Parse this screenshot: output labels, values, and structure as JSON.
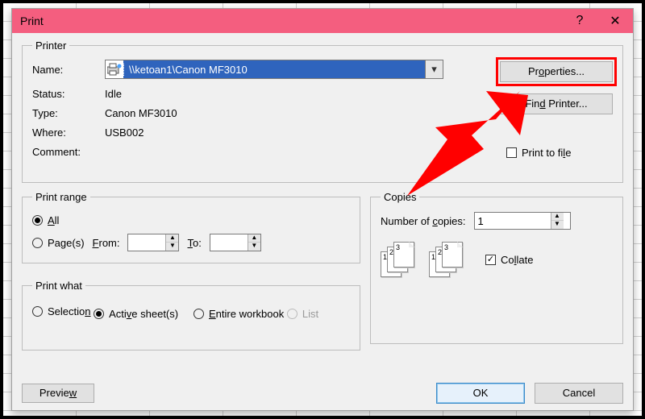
{
  "window": {
    "title": "Print"
  },
  "printer": {
    "legend": "Printer",
    "name_label": "Name:",
    "selected_printer": "\\\\ketoan1\\Canon MF3010",
    "status_label": "Status:",
    "status_value": "Idle",
    "type_label": "Type:",
    "type_value": "Canon MF3010",
    "where_label": "Where:",
    "where_value": "USB002",
    "comment_label": "Comment:",
    "properties_btn": "Properties...",
    "find_printer_btn": "Find Printer...",
    "print_to_file": "Print to file"
  },
  "print_range": {
    "legend": "Print range",
    "all": "All",
    "pages": "Page(s)",
    "from": "From:",
    "to": "To:"
  },
  "copies": {
    "legend": "Copies",
    "number_label": "Number of copies:",
    "number_value": "1",
    "collate": "Collate"
  },
  "print_what": {
    "legend": "Print what",
    "selection": "Selection",
    "entire_workbook": "Entire workbook",
    "active_sheets": "Active sheet(s)",
    "list": "List"
  },
  "footer": {
    "preview": "Preview",
    "ok": "OK",
    "cancel": "Cancel"
  }
}
